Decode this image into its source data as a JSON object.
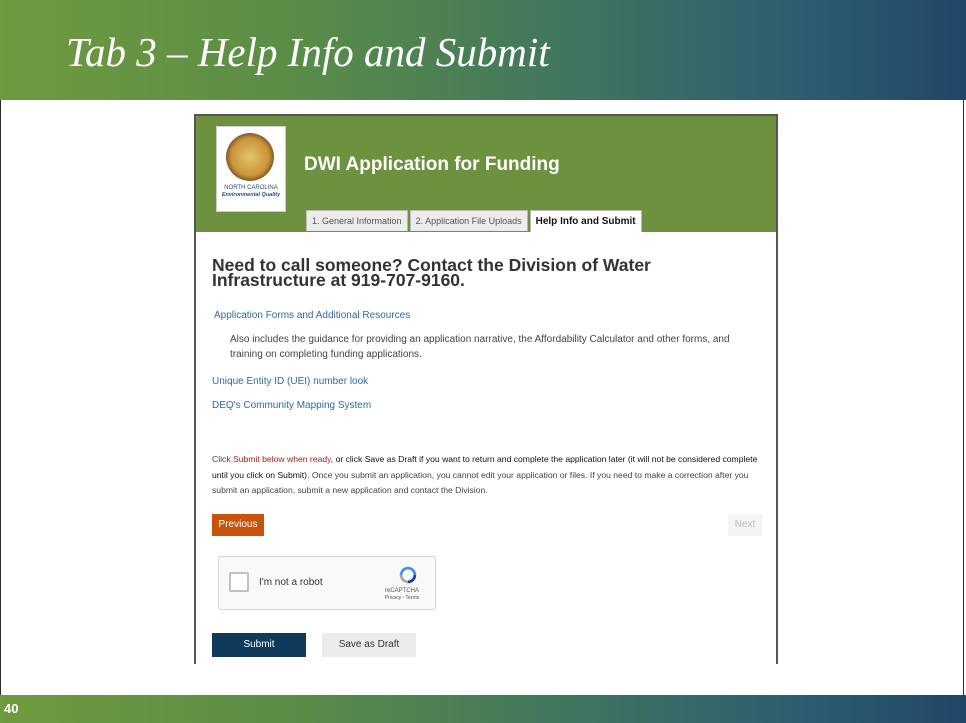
{
  "slide": {
    "title": "Tab 3 – Help Info and Submit",
    "number": "40"
  },
  "app": {
    "title": "DWI Application for Funding",
    "logo_line1": "NORTH CAROLINA",
    "logo_line2": "Environmental Quality",
    "tabs": [
      {
        "label": "1. General Information",
        "active": false
      },
      {
        "label": "2. Application File Uploads",
        "active": false
      },
      {
        "label": "Help Info and Submit",
        "active": true
      }
    ]
  },
  "content": {
    "heading": "Need to call someone? Contact the Division of Water Infrastructure at 919-707-9160.",
    "link_forms": "Application Forms and Additional Resources",
    "forms_description": "Also includes the guidance for providing an application narrative, the Affordability Calculator and other forms, and training on completing funding applications.",
    "link_uei": "Unique Entity ID (UEI) number look",
    "link_mapping": "DEQ's Community Mapping System",
    "notice_part1": "Click ",
    "notice_red": "Submit below when ready",
    "notice_part2": ", or click Save as Draft if you want to return and complete the application later (it will not be considered complete until you click on Submit)",
    "notice_part3": ". Once you submit an application, you cannot edit your application or files. If you need to make a correction after you submit an application, submit a new application and contact the Division."
  },
  "buttons": {
    "previous": "Previous",
    "next": "Next",
    "submit": "Submit",
    "save_draft": "Save as Draft"
  },
  "recaptcha": {
    "label": "I'm not a robot",
    "brand": "reCAPTCHA",
    "links": "Privacy - Terms"
  },
  "colors": {
    "header_green": "#6d913f",
    "previous_orange": "#c8530d",
    "submit_navy": "#103a5c",
    "link_blue": "#2f6aa3"
  }
}
